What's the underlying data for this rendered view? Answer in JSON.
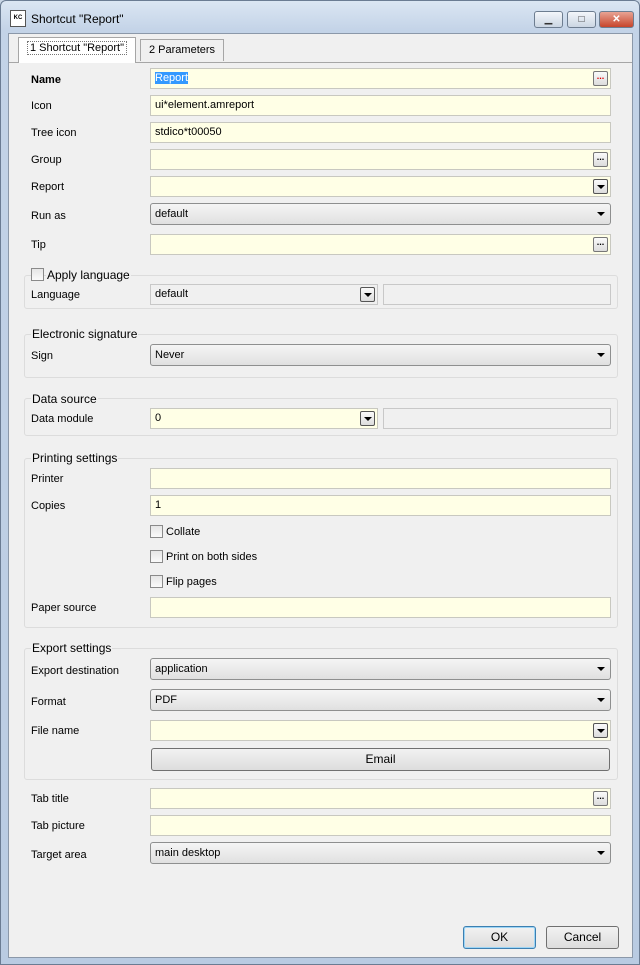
{
  "window": {
    "icon_text": "KC",
    "title": "Shortcut \"Report\"",
    "min_glyph": "▁",
    "max_glyph": "□",
    "close_glyph": "✕"
  },
  "tabs": [
    {
      "label": "1 Shortcut \"Report\""
    },
    {
      "label": "2 Parameters"
    }
  ],
  "form": {
    "name": {
      "label": "Name",
      "value": "Report",
      "button": "..."
    },
    "icon": {
      "label": "Icon",
      "value": "ui*element.amreport"
    },
    "tree_icon": {
      "label": "Tree icon",
      "value": "stdico*t00050"
    },
    "group": {
      "label": "Group",
      "value": "",
      "button": "..."
    },
    "report": {
      "label": "Report",
      "value": ""
    },
    "run_as": {
      "label": "Run as",
      "value": "default"
    },
    "tip": {
      "label": "Tip",
      "value": "",
      "button": "..."
    }
  },
  "apply_language": {
    "title": "Apply language",
    "checked": false,
    "language_label": "Language",
    "language_value": "default",
    "extra_value": ""
  },
  "electronic_signature": {
    "title": "Electronic signature",
    "sign_label": "Sign",
    "sign_value": "Never"
  },
  "data_source": {
    "title": "Data source",
    "module_label": "Data module",
    "module_value": "0",
    "extra_value": ""
  },
  "printing": {
    "title": "Printing settings",
    "printer_label": "Printer",
    "printer_value": "",
    "copies_label": "Copies",
    "copies_value": "1",
    "collate_label": "Collate",
    "collate_checked": false,
    "both_sides_label": "Print on both sides",
    "both_sides_checked": false,
    "flip_label": "Flip pages",
    "flip_checked": false,
    "paper_label": "Paper source",
    "paper_value": ""
  },
  "export": {
    "title": "Export settings",
    "destination_label": "Export destination",
    "destination_value": "application",
    "format_label": "Format",
    "format_value": "PDF",
    "filename_label": "File name",
    "filename_value": "",
    "email_label": "Email"
  },
  "tab_settings": {
    "title_label": "Tab title",
    "title_value": "",
    "title_button": "...",
    "picture_label": "Tab picture",
    "picture_value": "",
    "target_label": "Target area",
    "target_value": "main desktop"
  },
  "footer": {
    "ok_label": "OK",
    "cancel_label": "Cancel"
  }
}
